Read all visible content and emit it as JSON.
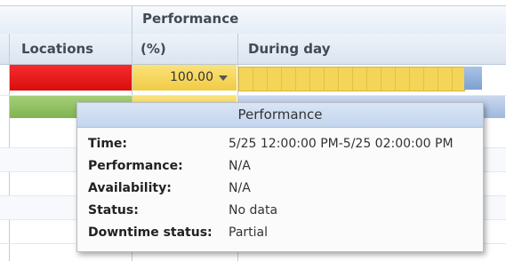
{
  "columns": {
    "group_header": "Performance",
    "locations": "Locations",
    "percent": "(%)",
    "during_day": "During day"
  },
  "row1": {
    "status_color": "#e51a1a",
    "performance_value": "100.00",
    "timeline_color": "#f4d558"
  },
  "row2": {
    "status_color": "#8fbf5f"
  },
  "tooltip": {
    "title": "Performance",
    "fields": [
      {
        "label": "Time:",
        "value": "5/25 12:00:00 PM-5/25 02:00:00 PM"
      },
      {
        "label": "Performance:",
        "value": "N/A"
      },
      {
        "label": "Availability:",
        "value": "N/A"
      },
      {
        "label": "Status:",
        "value": "No data"
      },
      {
        "label": "Downtime status:",
        "value": "Partial"
      }
    ]
  }
}
